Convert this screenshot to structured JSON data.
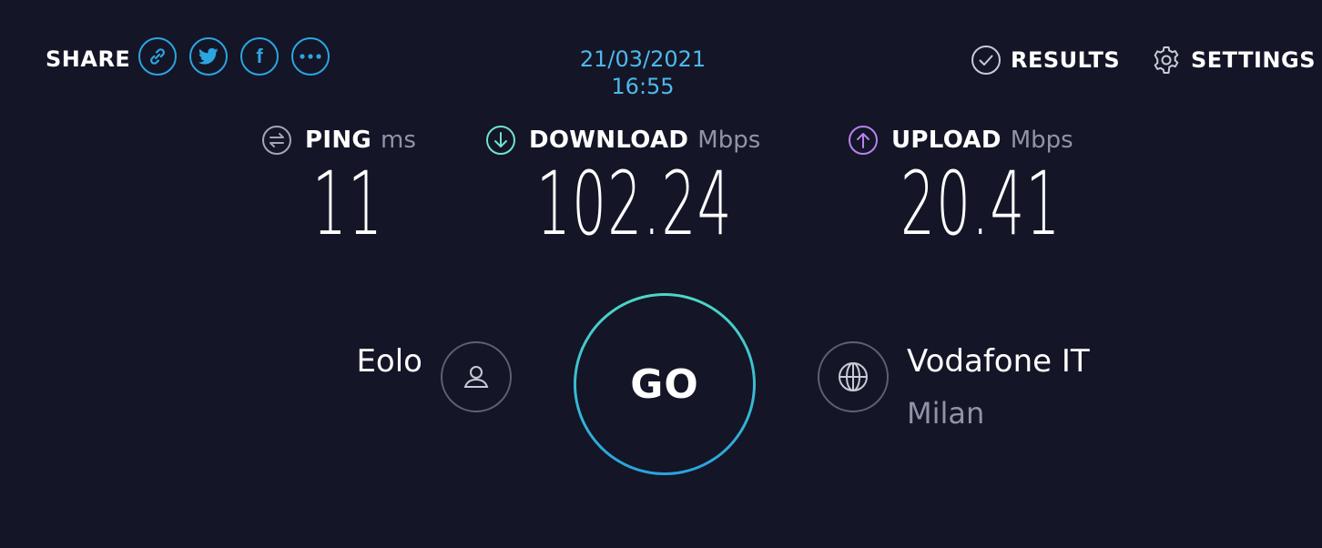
{
  "header": {
    "share_label": "SHARE",
    "share_buttons": [
      {
        "icon": "link-icon",
        "label": "Copy link"
      },
      {
        "icon": "twitter-icon",
        "label": "Twitter"
      },
      {
        "icon": "facebook-icon",
        "label": "f"
      },
      {
        "icon": "more-icon",
        "label": "More"
      }
    ],
    "timestamp": "21/03/2021 16:55",
    "results_label": "RESULTS",
    "settings_label": "SETTINGS"
  },
  "metrics": {
    "ping": {
      "label": "PING",
      "unit": "ms",
      "value": "11",
      "icon": "ping-icon",
      "color": "#a3a5b8"
    },
    "download": {
      "label": "DOWNLOAD",
      "unit": "Mbps",
      "value": "102.24",
      "icon": "download-arrow-icon",
      "color": "#6fe3d4"
    },
    "upload": {
      "label": "UPLOAD",
      "unit": "Mbps",
      "value": "20.41",
      "icon": "upload-arrow-icon",
      "color": "#b783f0"
    }
  },
  "connection": {
    "isp_name": "Eolo",
    "go_label": "GO",
    "server_name": "Vodafone IT",
    "server_location": "Milan"
  },
  "colors": {
    "background": "#141526",
    "accent_blue": "#2aa6e3",
    "muted_text": "#9193a8"
  }
}
